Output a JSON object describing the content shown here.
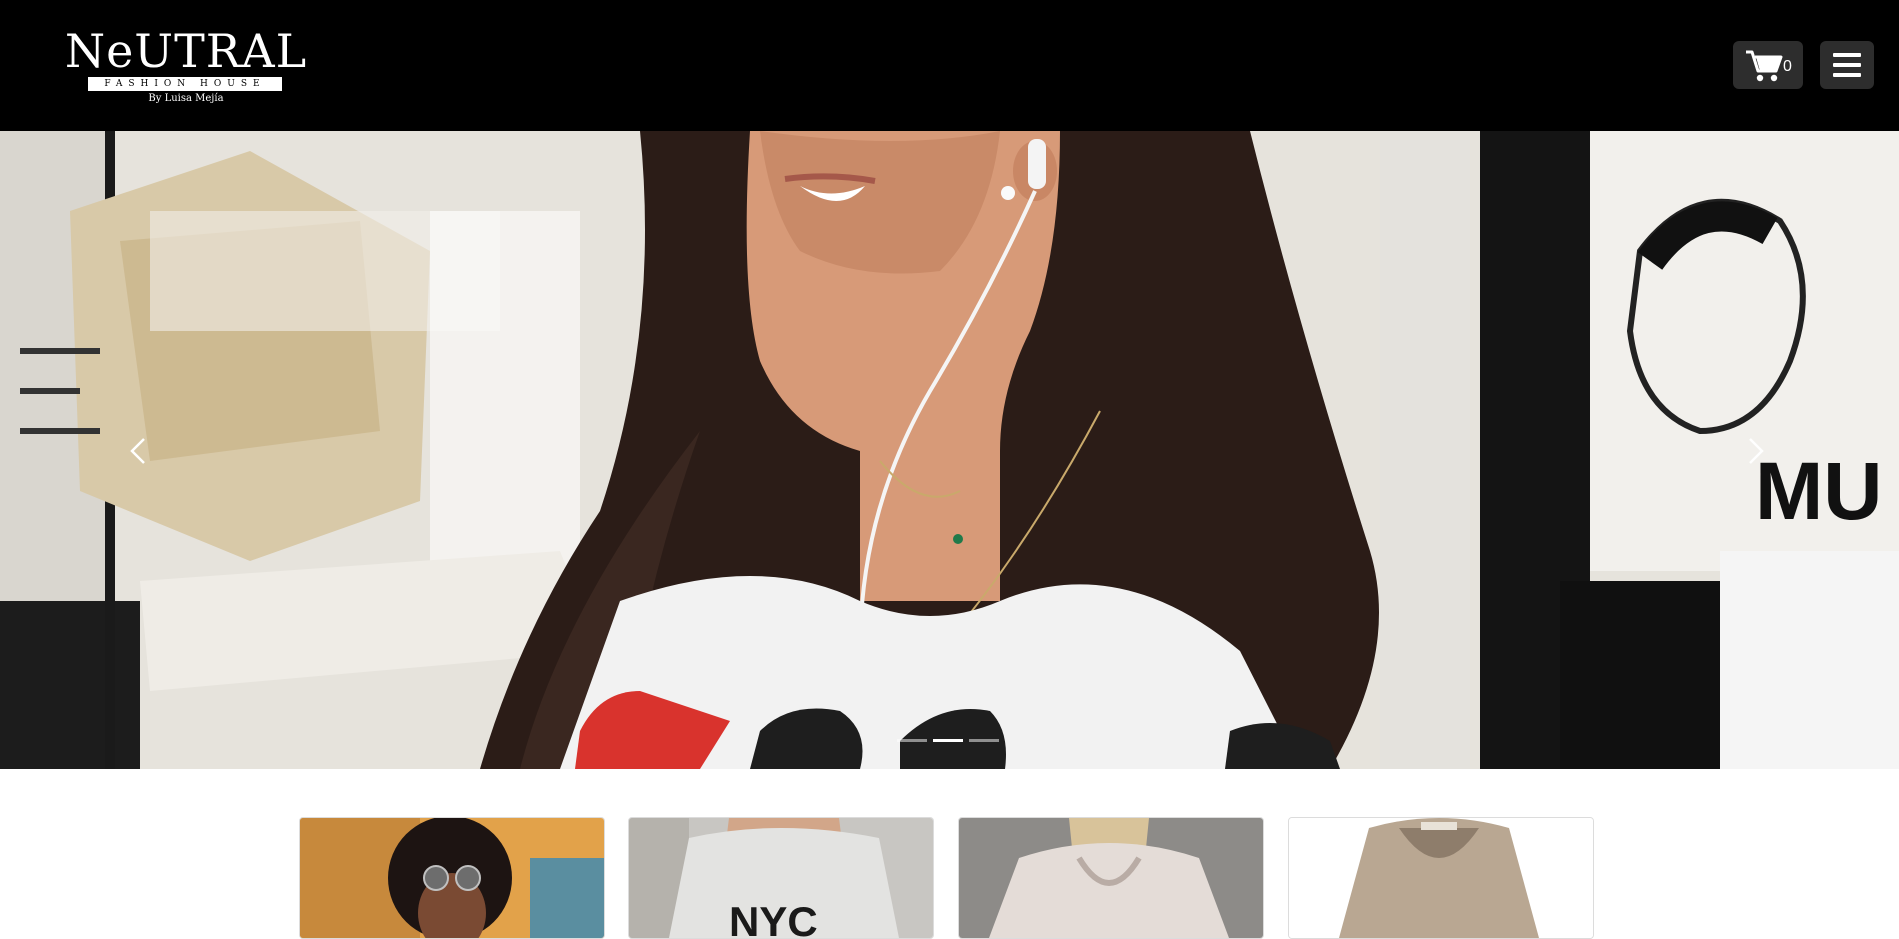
{
  "header": {
    "logo": {
      "main": "NeUTRAL",
      "band": "FASHION HOUSE",
      "byline": "By Luisa Mejía"
    },
    "cart": {
      "icon": "cart-icon",
      "count": "0"
    },
    "menu": {
      "icon": "hamburger-icon"
    }
  },
  "hero": {
    "slides_total": 3,
    "active_slide": 2,
    "prev_icon": "chevron-left-icon",
    "next_icon": "chevron-right-icon",
    "poster_text": "MU"
  },
  "products": {
    "cards": [
      {
        "image": "woman-sunglasses-photo"
      },
      {
        "image": "nyc-sweatshirt-photo"
      },
      {
        "image": "hoodie-back-photo"
      },
      {
        "image": "beige-hoodie-photo"
      }
    ]
  },
  "colors": {
    "header_bg": "#000000",
    "button_bg": "#2d2d2d",
    "page_bg": "#ffffff"
  }
}
